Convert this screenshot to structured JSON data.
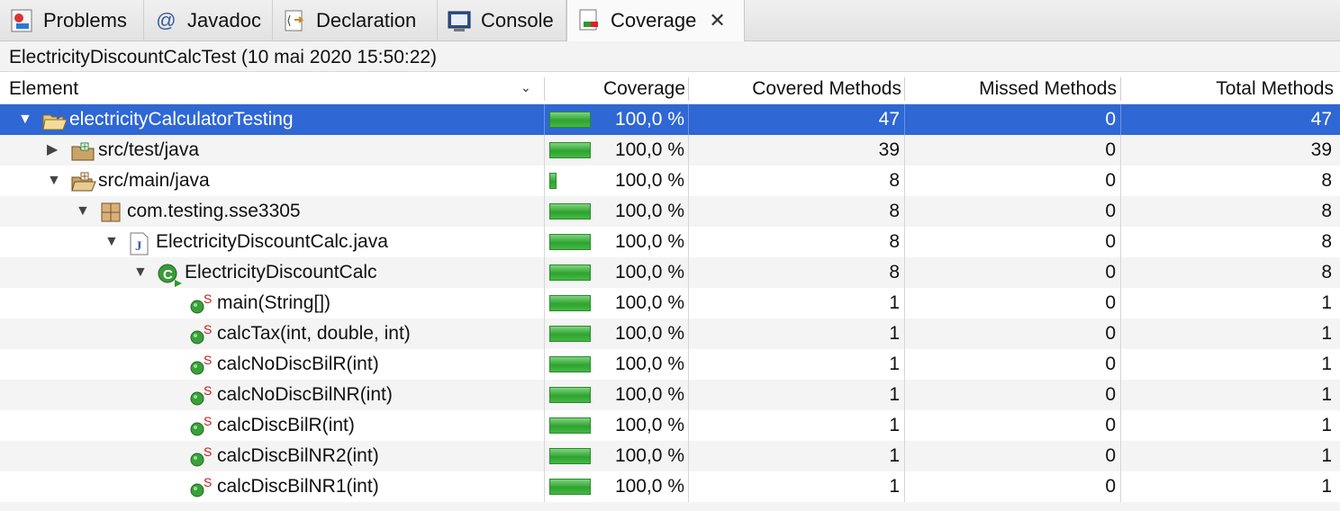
{
  "tabs": [
    {
      "label": "Problems",
      "icon": "problems-icon"
    },
    {
      "label": "Javadoc",
      "icon": "at-icon"
    },
    {
      "label": "Declaration",
      "icon": "declaration-icon"
    },
    {
      "label": "Console",
      "icon": "console-icon"
    },
    {
      "label": "Coverage",
      "icon": "coverage-icon",
      "active": true,
      "close": "✕"
    }
  ],
  "session_title": "ElectricityDiscountCalcTest (10 mai 2020 15:50:22)",
  "columns": {
    "element": "Element",
    "coverage": "Coverage",
    "covered": "Covered Methods",
    "missed": "Missed Methods",
    "total": "Total Methods"
  },
  "rows": [
    {
      "name": "electricityCalculatorTesting",
      "depth": 0,
      "expand": "▼",
      "icon": "project-icon",
      "coverage": "100,0 %",
      "coverage_bar": 1.0,
      "covered": "47",
      "missed": "0",
      "total": "47",
      "selected": true
    },
    {
      "name": "src/test/java",
      "depth": 1,
      "expand": "▶",
      "icon": "source-folder-icon",
      "coverage": "100,0 %",
      "coverage_bar": 1.0,
      "covered": "39",
      "missed": "0",
      "total": "39"
    },
    {
      "name": "src/main/java",
      "depth": 1,
      "expand": "▼",
      "icon": "source-folder-open-icon",
      "coverage": "100,0 %",
      "coverage_bar": 0.17,
      "covered": "8",
      "missed": "0",
      "total": "8"
    },
    {
      "name": "com.testing.sse3305",
      "depth": 2,
      "expand": "▼",
      "icon": "package-icon",
      "coverage": "100,0 %",
      "coverage_bar": 1.0,
      "covered": "8",
      "missed": "0",
      "total": "8"
    },
    {
      "name": "ElectricityDiscountCalc.java",
      "depth": 3,
      "expand": "▼",
      "icon": "java-file-icon",
      "coverage": "100,0 %",
      "coverage_bar": 1.0,
      "covered": "8",
      "missed": "0",
      "total": "8"
    },
    {
      "name": "ElectricityDiscountCalc",
      "depth": 4,
      "expand": "▼",
      "icon": "class-icon",
      "coverage": "100,0 %",
      "coverage_bar": 1.0,
      "covered": "8",
      "missed": "0",
      "total": "8"
    },
    {
      "name": "main(String[])",
      "depth": 5,
      "expand": "",
      "icon": "static-method-icon",
      "coverage": "100,0 %",
      "coverage_bar": 1.0,
      "covered": "1",
      "missed": "0",
      "total": "1"
    },
    {
      "name": "calcTax(int, double, int)",
      "depth": 5,
      "expand": "",
      "icon": "static-method-icon",
      "coverage": "100,0 %",
      "coverage_bar": 1.0,
      "covered": "1",
      "missed": "0",
      "total": "1"
    },
    {
      "name": "calcNoDiscBilR(int)",
      "depth": 5,
      "expand": "",
      "icon": "static-method-icon",
      "coverage": "100,0 %",
      "coverage_bar": 1.0,
      "covered": "1",
      "missed": "0",
      "total": "1"
    },
    {
      "name": "calcNoDiscBilNR(int)",
      "depth": 5,
      "expand": "",
      "icon": "static-method-icon",
      "coverage": "100,0 %",
      "coverage_bar": 1.0,
      "covered": "1",
      "missed": "0",
      "total": "1"
    },
    {
      "name": "calcDiscBilR(int)",
      "depth": 5,
      "expand": "",
      "icon": "static-method-icon",
      "coverage": "100,0 %",
      "coverage_bar": 1.0,
      "covered": "1",
      "missed": "0",
      "total": "1"
    },
    {
      "name": "calcDiscBilNR2(int)",
      "depth": 5,
      "expand": "",
      "icon": "static-method-icon",
      "coverage": "100,0 %",
      "coverage_bar": 1.0,
      "covered": "1",
      "missed": "0",
      "total": "1"
    },
    {
      "name": "calcDiscBilNR1(int)",
      "depth": 5,
      "expand": "",
      "icon": "static-method-icon",
      "coverage": "100,0 %",
      "coverage_bar": 1.0,
      "covered": "1",
      "missed": "0",
      "total": "1"
    }
  ],
  "colors": {
    "selection": "#2f67d4",
    "bar_green": "#3fae3f",
    "tab_active": "#fafafa"
  }
}
